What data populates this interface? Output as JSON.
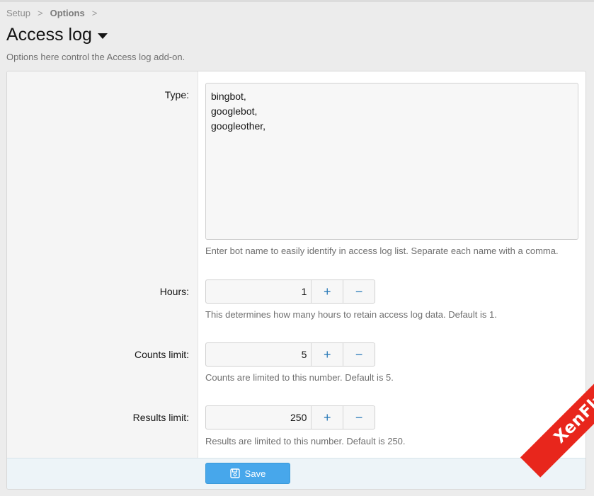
{
  "breadcrumb": {
    "items": [
      "Setup",
      "Options"
    ],
    "separator": ">"
  },
  "page": {
    "title": "Access log",
    "description": "Options here control the Access log add-on."
  },
  "fields": {
    "type": {
      "label": "Type:",
      "lines": [
        "bingbot,",
        "googlebot,",
        "googleother,"
      ],
      "hint": "Enter bot name to easily identify in access log list. Separate each name with a comma."
    },
    "hours": {
      "label": "Hours:",
      "value": "1",
      "hint": "This determines how many hours to retain access log data. Default is 1."
    },
    "counts_limit": {
      "label": "Counts limit:",
      "value": "5",
      "hint": "Counts are limited to this number. Default is 5."
    },
    "results_limit": {
      "label": "Results limit:",
      "value": "250",
      "hint": "Results are limited to this number. Default is 250."
    }
  },
  "stepper": {
    "plus": "+",
    "minus": "−"
  },
  "footer": {
    "save_label": "Save"
  },
  "watermark": {
    "text": "XenFly.com"
  },
  "colors": {
    "accent": "#47a7eb",
    "link": "#2b7bb9",
    "watermark": "#e8261c"
  }
}
